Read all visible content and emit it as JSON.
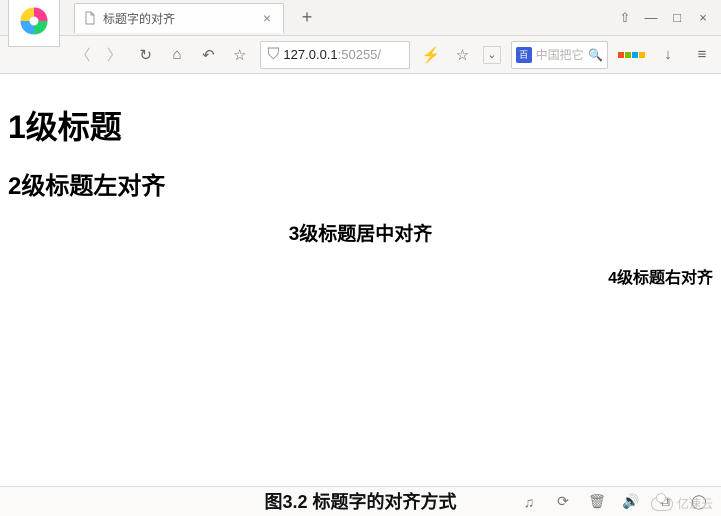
{
  "window": {
    "tab_title": "标题字的对齐",
    "pin_icon": "pin-icon",
    "minimize": "—",
    "maximize": "□",
    "close": "×"
  },
  "toolbar": {
    "address_host": "127.0.0.1",
    "address_port": ":50255/",
    "search_engine_label": "百",
    "search_placeholder": "中国把它"
  },
  "page": {
    "h1": "1级标题",
    "h2": "2级标题左对齐",
    "h3": "3级标题居中对齐",
    "h4": "4级标题右对齐"
  },
  "caption": "图3.2 标题字的对齐方式",
  "watermark": "亿速云"
}
